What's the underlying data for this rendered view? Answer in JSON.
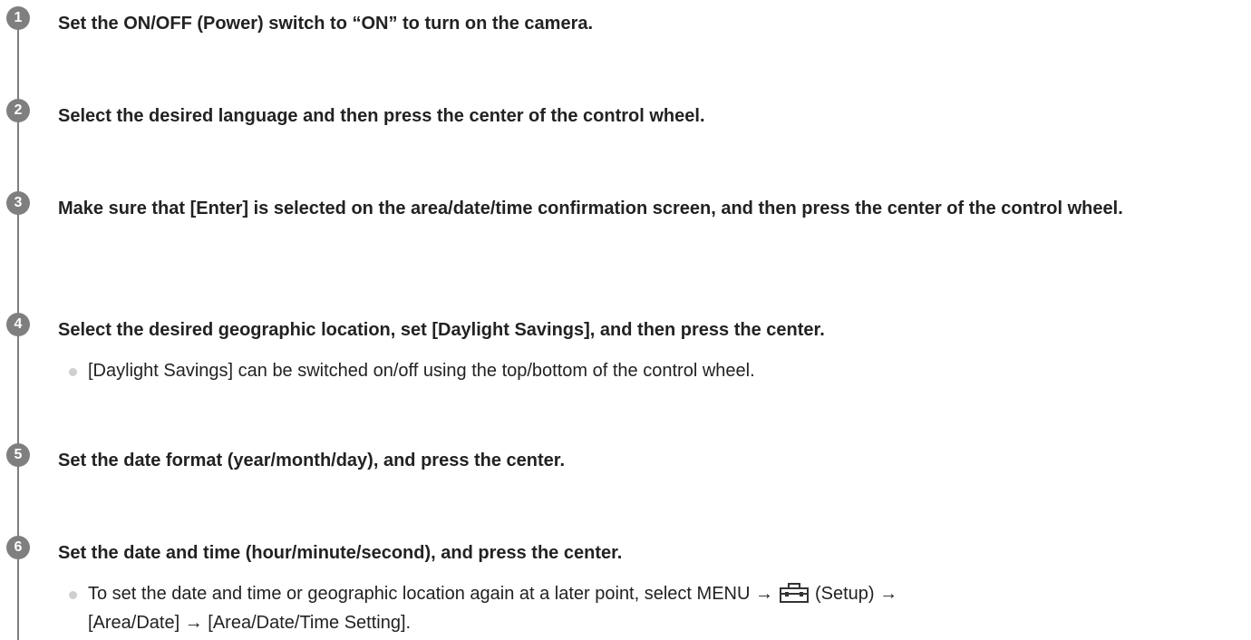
{
  "steps": [
    {
      "number": "1",
      "text": "Set the ON/OFF (Power) switch to “ON” to turn on the camera."
    },
    {
      "number": "2",
      "text": "Select the desired language and then press the center of the control wheel."
    },
    {
      "number": "3",
      "text": "Make sure that [Enter] is selected on the area/date/time confirmation screen, and then press the center of the control wheel."
    },
    {
      "number": "4",
      "text": "Select the desired geographic location, set [Daylight Savings], and then press the center."
    },
    {
      "number": "5",
      "text": "Set the date format (year/month/day), and press the center."
    },
    {
      "number": "6",
      "text": "Set the date and time (hour/minute/second), and press the center."
    }
  ],
  "notes": {
    "step4": "[Daylight Savings] can be switched on/off using the top/bottom of the control wheel.",
    "step6_line1_before_icon": "To set the date and time or geographic location again at a later point, select MENU →",
    "step6_line1_after_icon": "(Setup) →",
    "step6_line2": "[Area/Date] → [Area/Date/Time Setting].",
    "setup_icon": "toolbox-icon"
  },
  "colors": {
    "timeline": "#7f7f7f",
    "badge": "#7f7f7f",
    "bullet": "#cfcfcf",
    "text": "#222222"
  }
}
